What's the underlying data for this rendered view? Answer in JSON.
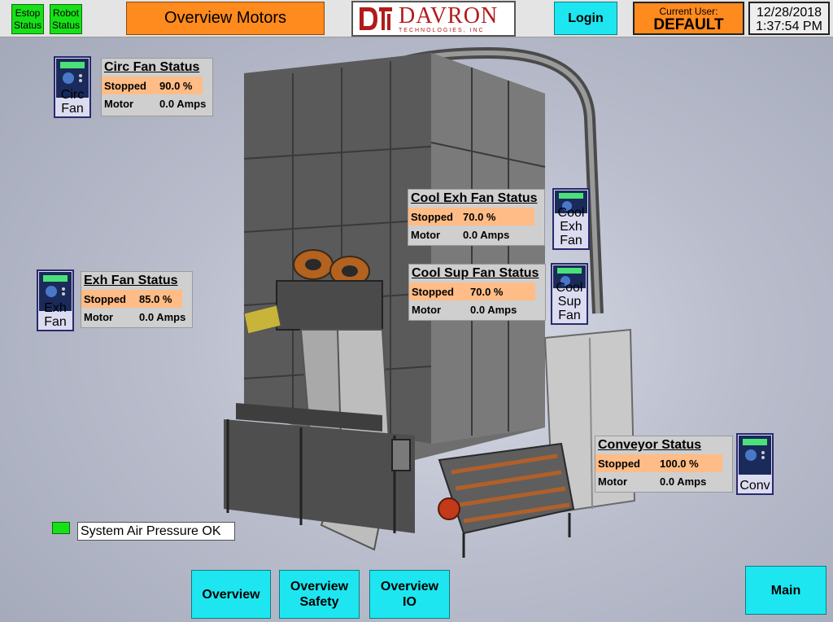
{
  "header": {
    "estop_label": "Estop\nStatus",
    "robot_label": "Robot\nStatus",
    "title": "Overview Motors",
    "logo_main": "DAVRON",
    "logo_sub": "TECHNOLOGIES, INC",
    "login_label": "Login",
    "user_label": "Current User:",
    "user_name": "DEFAULT",
    "date": "12/28/2018",
    "time": "1:37:54 PM"
  },
  "motors": {
    "circ_fan": {
      "icon_label": "Circ\nFan",
      "title": "Circ Fan Status",
      "state": "Stopped",
      "speed": "90.0 %",
      "motor_label": "Motor",
      "amps": "0.0 Amps"
    },
    "cool_exh_fan": {
      "icon_label": "Cool\nExh\nFan",
      "title": "Cool Exh Fan Status",
      "state": "Stopped",
      "speed": "70.0 %",
      "motor_label": "Motor",
      "amps": "0.0 Amps"
    },
    "exh_fan": {
      "icon_label": "Exh\nFan",
      "title": "Exh Fan Status",
      "state": "Stopped",
      "speed": "85.0 %",
      "motor_label": "Motor",
      "amps": "0.0 Amps"
    },
    "cool_sup_fan": {
      "icon_label": "Cool\nSup\nFan",
      "title": "Cool Sup Fan Status",
      "state": "Stopped",
      "speed": "70.0 %",
      "motor_label": "Motor",
      "amps": "0.0 Amps"
    },
    "conveyor": {
      "icon_label": "Conv",
      "title": "Conveyor Status",
      "state": "Stopped",
      "speed": "100.0 %",
      "motor_label": "Motor",
      "amps": "0.0 Amps"
    }
  },
  "system": {
    "air_pressure_label": "System Air Pressure OK"
  },
  "nav": {
    "overview": "Overview",
    "overview_safety": "Overview\nSafety",
    "overview_io": "Overview\nIO",
    "main": "Main"
  },
  "colors": {
    "status_ok": "#18e018",
    "accent_orange": "#ff8a1d",
    "nav_cyan": "#1ee6f0",
    "logo_red": "#b21b1b"
  }
}
